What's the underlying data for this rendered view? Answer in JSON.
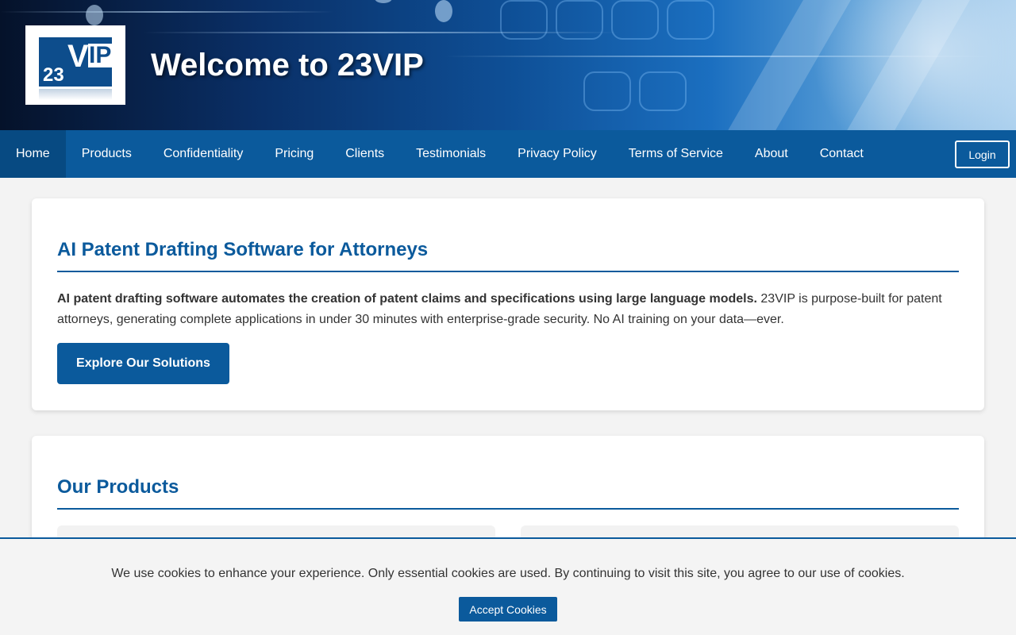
{
  "header": {
    "logo": {
      "text_23": "23",
      "text_v": "V",
      "text_ip": "IP"
    },
    "title": "Welcome to 23VIP"
  },
  "nav": {
    "items": [
      {
        "label": "Home",
        "active": true
      },
      {
        "label": "Products"
      },
      {
        "label": "Confidentiality"
      },
      {
        "label": "Pricing"
      },
      {
        "label": "Clients"
      },
      {
        "label": "Testimonials"
      },
      {
        "label": "Privacy Policy"
      },
      {
        "label": "Terms of Service"
      },
      {
        "label": "About"
      },
      {
        "label": "Contact"
      }
    ],
    "login_label": "Login"
  },
  "hero": {
    "heading": "AI Patent Drafting Software for Attorneys",
    "intro_bold": "AI patent drafting software automates the creation of patent claims and specifications using large language models.",
    "intro_rest": " 23VIP is purpose-built for patent attorneys, generating complete applications in under 30 minutes with enterprise-grade security. No AI training on your data—ever.",
    "cta_label": "Explore Our Solutions"
  },
  "products": {
    "heading": "Our Products"
  },
  "cookie": {
    "message": "We use cookies to enhance your experience. Only essential cookies are used. By continuing to visit this site, you agree to our use of cookies.",
    "accept_label": "Accept Cookies"
  },
  "colors": {
    "brand_blue": "#0b5a9c",
    "nav_active": "#074a82"
  }
}
